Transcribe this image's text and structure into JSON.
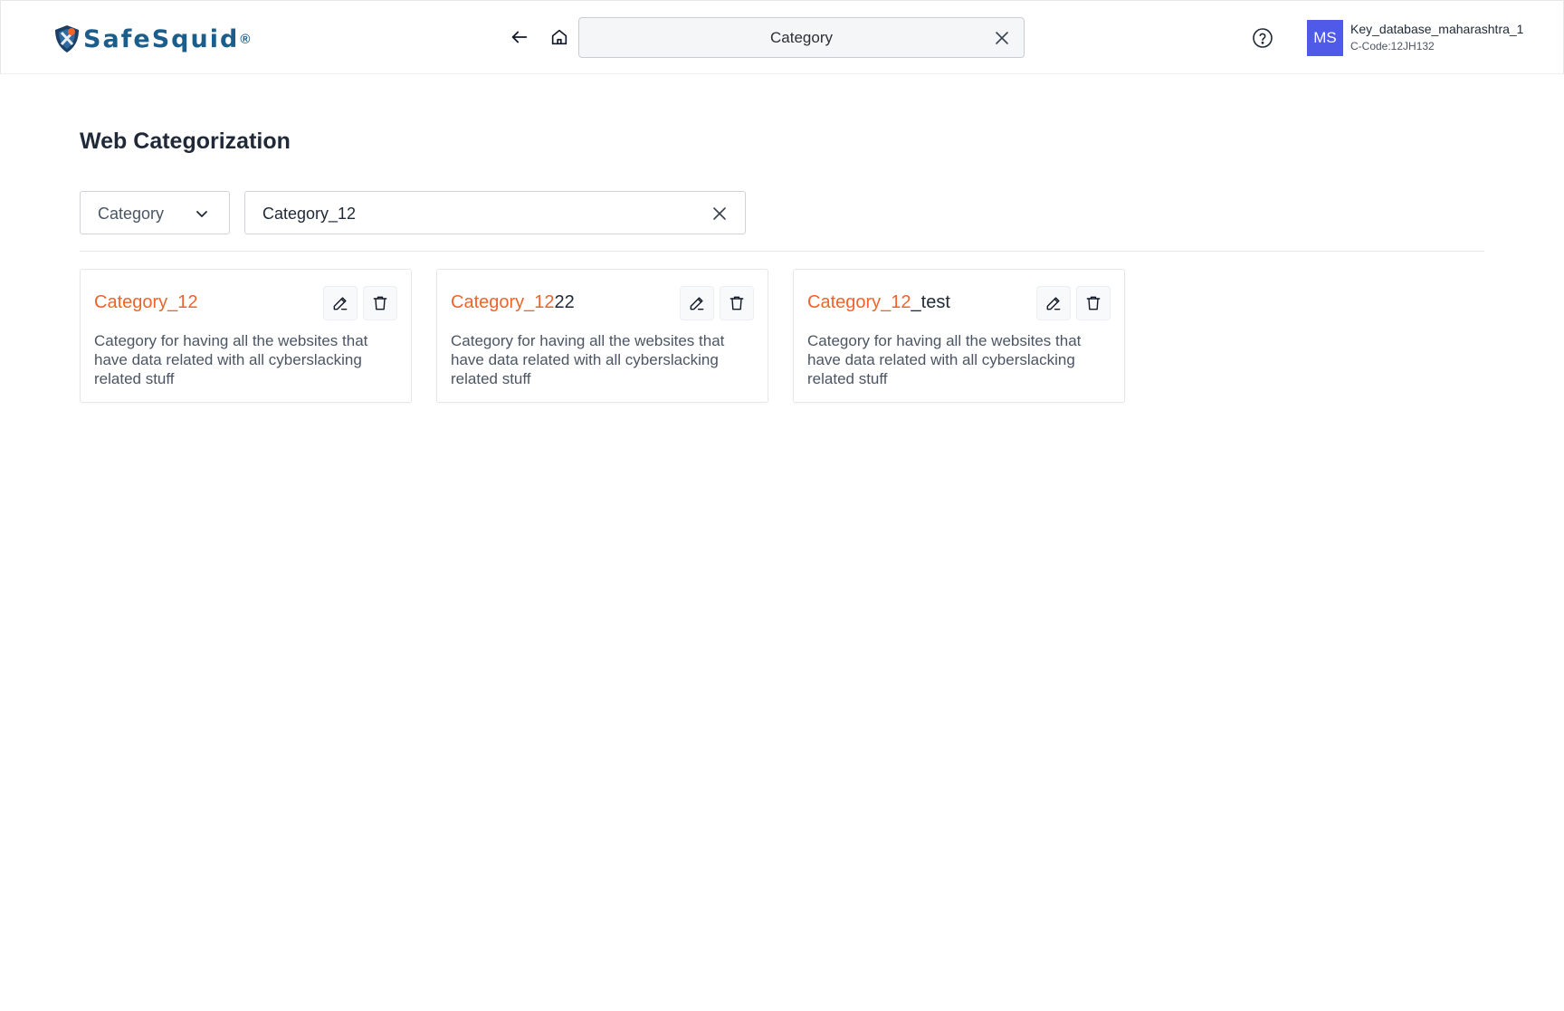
{
  "header": {
    "brand": "SafeSquid",
    "brand_mark": "®",
    "global_search_value": "Category",
    "user_initials": "MS",
    "user_name": "Key_database_maharashtra_1",
    "user_code": "C-Code:12JH132"
  },
  "icons": {
    "back": "arrow-left-icon",
    "home": "home-icon",
    "clear": "close-icon",
    "help": "help-circle-icon",
    "dropdown": "chevron-down-icon",
    "edit": "pencil-icon",
    "delete": "trash-icon"
  },
  "main": {
    "title": "Web Categorization",
    "filter_type": "Category",
    "search_value": "Category_12"
  },
  "cards": [
    {
      "match": "Category_12",
      "rest": "",
      "description": "Category for having all the websites that have data related with all cyberslacking related stuff"
    },
    {
      "match": "Category_12",
      "rest": "22",
      "description": "Category for having all the websites that have data related with all cyberslacking related stuff"
    },
    {
      "match": "Category_12",
      "rest": "_test",
      "description": "Category for having all the websites that have data related with all cyberslacking related stuff"
    }
  ],
  "colors": {
    "brand": "#1b5e8c",
    "highlight": "#f0632b",
    "avatar": "#4f5be8"
  }
}
